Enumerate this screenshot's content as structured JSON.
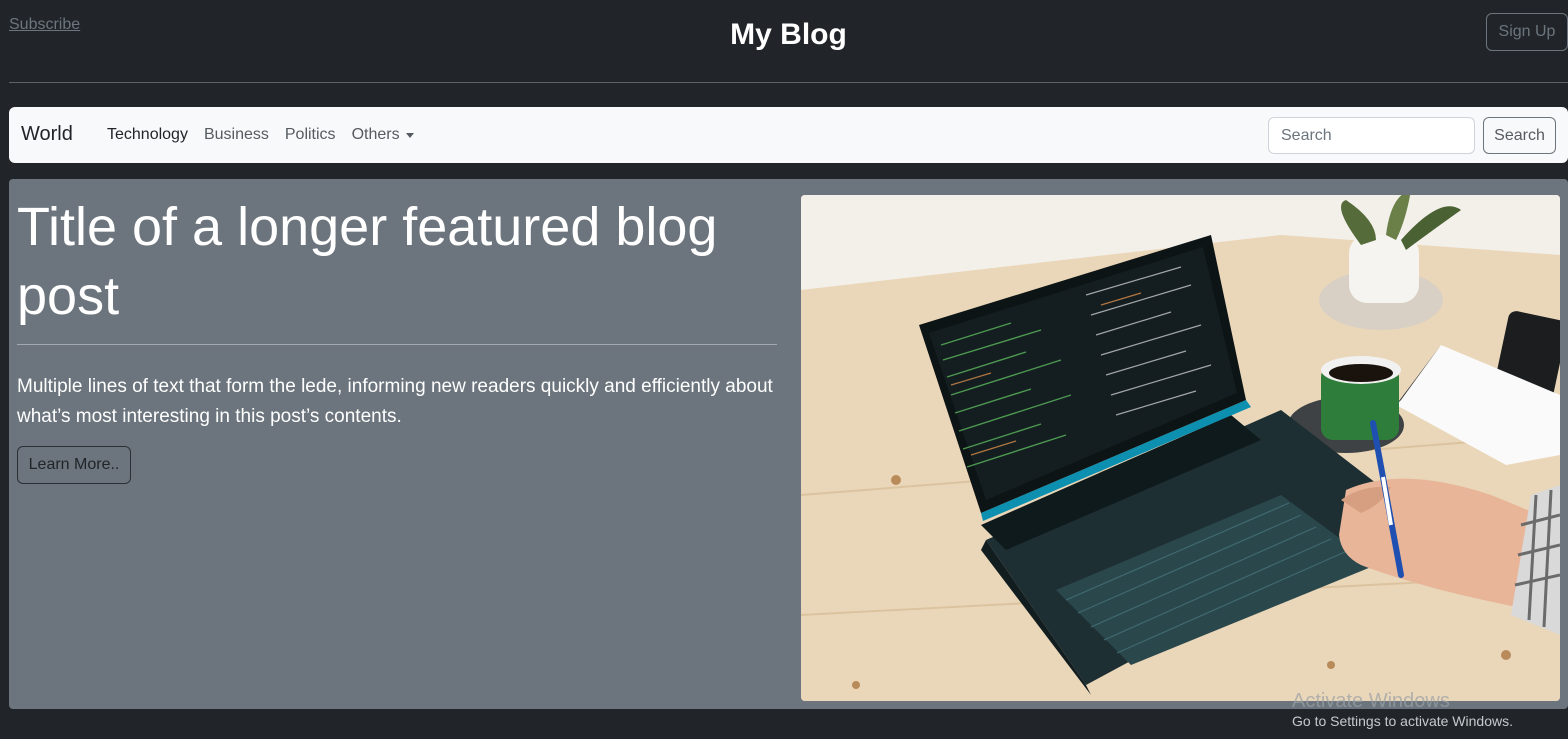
{
  "header": {
    "subscribe_label": "Subscribe",
    "title": "My Blog",
    "signup_label": "Sign Up"
  },
  "navbar": {
    "brand": "World",
    "links": [
      {
        "label": "Technology"
      },
      {
        "label": "Business"
      },
      {
        "label": "Politics"
      },
      {
        "label": "Others"
      }
    ],
    "search": {
      "placeholder": "Search",
      "button_label": "Search"
    }
  },
  "feature": {
    "title": "Title of a longer featured blog post",
    "lede": "Multiple lines of text that form the lede, informing new readers quickly and efficiently about what’s most interesting in this post’s contents.",
    "button_label": "Learn More.."
  },
  "watermark": {
    "title": "Activate Windows",
    "subtitle": "Go to Settings to activate Windows."
  },
  "colors": {
    "page_bg": "#212529",
    "navbar_bg": "#f8f9fa",
    "feature_bg": "#6c757d"
  }
}
